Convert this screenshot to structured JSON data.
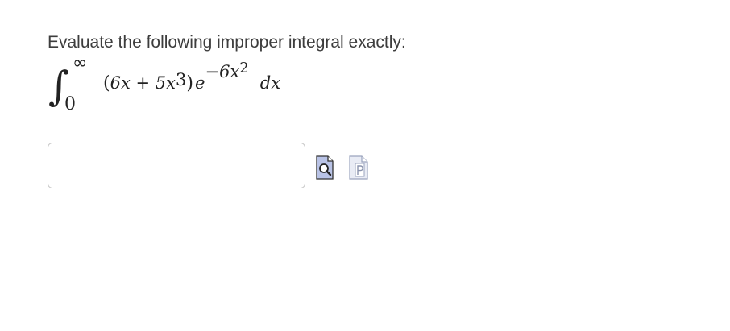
{
  "question": {
    "prompt": "Evaluate the following improper integral exactly:"
  },
  "integral": {
    "upper_limit": "∞",
    "lower_limit": "0",
    "open_paren": "(",
    "term1": "6x",
    "plus": " + ",
    "term2_coef": "5x",
    "term2_power": "3",
    "close_paren": ")",
    "base": "e",
    "exp_coef": "−6x",
    "exp_power": "2",
    "differential": "dx"
  },
  "answer": {
    "value": "",
    "placeholder": ""
  },
  "icons": {
    "preview": "preview-icon",
    "pdf": "pdf-icon"
  },
  "colors": {
    "input_border": "#c8c8c8",
    "preview_icon_fill": "#b9c3e6",
    "pdf_icon_fill": "#e9ecf5"
  }
}
